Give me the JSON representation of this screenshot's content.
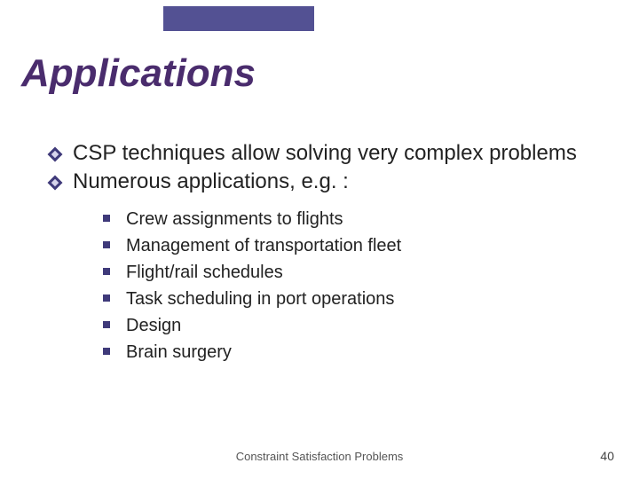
{
  "slide": {
    "title": "Applications",
    "bullets_l1": [
      "CSP techniques allow solving very complex problems",
      "Numerous applications, e.g. :"
    ],
    "bullets_l2": [
      "Crew assignments to flights",
      "Management of transportation fleet",
      "Flight/rail schedules",
      "Task scheduling in port operations",
      "Design",
      "Brain surgery"
    ],
    "footer_center": "Constraint Satisfaction Problems",
    "page_number": "40"
  }
}
